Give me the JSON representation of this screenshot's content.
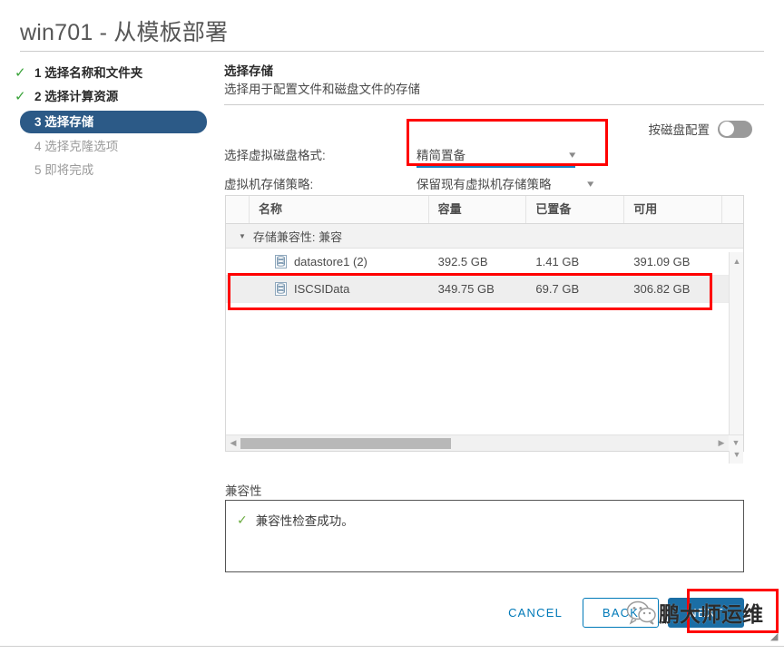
{
  "window": {
    "title": "win701 - 从模板部署",
    "resize_grip_icon": "resize-grip-icon"
  },
  "steps": [
    {
      "num": "1",
      "label": "选择名称和文件夹",
      "state": "done",
      "check_icon": "check-icon"
    },
    {
      "num": "2",
      "label": "选择计算资源",
      "state": "done",
      "check_icon": "check-icon"
    },
    {
      "num": "3",
      "label": "选择存储",
      "state": "active",
      "check_icon": ""
    },
    {
      "num": "4",
      "label": "选择克隆选项",
      "state": "pending",
      "check_icon": ""
    },
    {
      "num": "5",
      "label": "即将完成",
      "state": "pending",
      "check_icon": ""
    }
  ],
  "panel": {
    "heading": "选择存储",
    "subheading": "选择用于配置文件和磁盘文件的存储"
  },
  "toggle": {
    "label": "按磁盘配置",
    "state": "off",
    "icon": "toggle-switch-icon"
  },
  "form": {
    "disk_format": {
      "label": "选择虚拟磁盘格式:",
      "value": "精简置备",
      "caret_icon": "chevron-down-icon"
    },
    "storage_policy": {
      "label": "虚拟机存储策略:",
      "value": "保留现有虚拟机存储策略",
      "caret_icon": "chevron-down-icon"
    }
  },
  "table": {
    "columns": [
      "",
      "名称",
      "容量",
      "已置备",
      "可用",
      ""
    ],
    "group": {
      "label": "存储兼容性: 兼容",
      "expander_icon": "triangle-down-icon"
    },
    "rows": [
      {
        "icon": "datastore-icon",
        "name": "datastore1 (2)",
        "capacity": "392.5 GB",
        "provisioned": "1.41 GB",
        "free": "391.09 GB",
        "selected": false
      },
      {
        "icon": "datastore-icon",
        "name": "ISCSIData",
        "capacity": "349.75 GB",
        "provisioned": "69.7 GB",
        "free": "306.82 GB",
        "selected": true
      }
    ],
    "scrollbars": {
      "v_up_icon": "caret-up-icon",
      "v_down_icon": "caret-down-icon",
      "h_left_icon": "caret-left-icon",
      "h_right_icon": "caret-right-icon",
      "corner_icon": "caret-down-icon"
    }
  },
  "compatibility": {
    "label": "兼容性",
    "message": "兼容性检查成功。",
    "status_icon": "check-icon"
  },
  "footer": {
    "cancel_label": "CANCEL",
    "back_label": "BACK",
    "next_label": "NEXT"
  },
  "watermark": {
    "text": "鹏大师运维",
    "icon": "wechat-icon"
  },
  "annotations": {
    "disk_format_highlight": "red-box",
    "selected_row_highlight": "red-box",
    "next_button_highlight": "red-box"
  },
  "colors": {
    "accent": "#0079b8",
    "primary_button": "#1b6ea5",
    "active_step": "#2c5a87",
    "check_green": "#3aa33a",
    "annotation_red": "#ff0000"
  }
}
